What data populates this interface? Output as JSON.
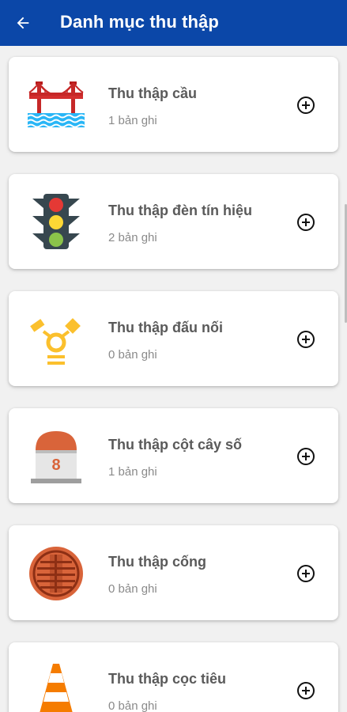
{
  "header": {
    "title": "Danh mục thu thập",
    "back_icon": "arrow-left-icon"
  },
  "colors": {
    "appbar": "#0b47a8",
    "card_background": "#ffffff",
    "title_text": "#5a5a5a",
    "subtitle_text": "#8a8a8a"
  },
  "items": [
    {
      "title": "Thu thập cầu",
      "count": "1 bản ghi",
      "icon": "bridge-icon",
      "action_icon": "add-circle-icon"
    },
    {
      "title": "Thu thập đèn tín hiệu",
      "count": "2 bản ghi",
      "icon": "traffic-light-icon",
      "action_icon": "add-circle-icon"
    },
    {
      "title": "Thu thập đấu nối",
      "count": "0 bản ghi",
      "icon": "connector-icon",
      "action_icon": "add-circle-icon"
    },
    {
      "title": "Thu thập cột cây số",
      "count": "1 bản ghi",
      "icon": "milestone-icon",
      "action_icon": "add-circle-icon",
      "milestone_number": "8"
    },
    {
      "title": "Thu thập cống",
      "count": "0 bản ghi",
      "icon": "manhole-icon",
      "action_icon": "add-circle-icon"
    },
    {
      "title": "Thu thập cọc tiêu",
      "count": "0 bản ghi",
      "icon": "traffic-cone-icon",
      "action_icon": "add-circle-icon"
    }
  ]
}
